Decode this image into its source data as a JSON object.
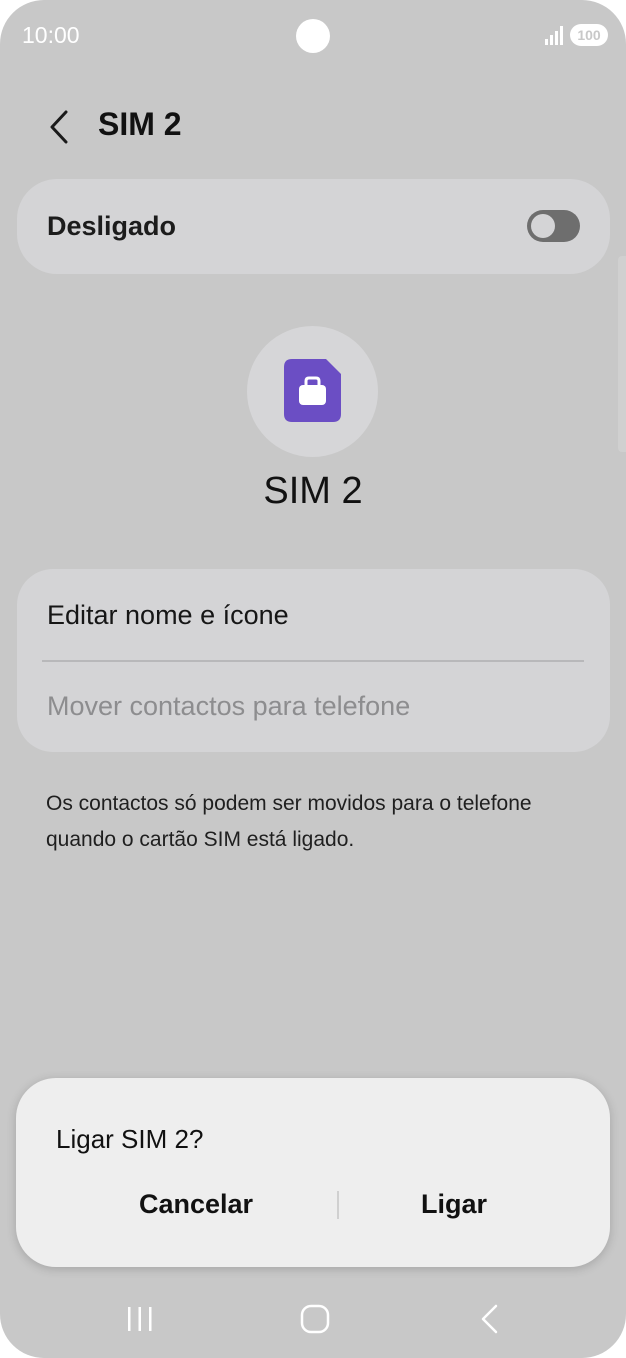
{
  "status_bar": {
    "time": "10:00",
    "battery": "100",
    "icons": [
      "signal-icon",
      "battery-icon"
    ]
  },
  "header": {
    "title": "SIM 2",
    "back_icon": "chevron-left-icon"
  },
  "sim_toggle": {
    "label": "Desligado",
    "state": "off"
  },
  "sim_info": {
    "icon": "sim-card-icon",
    "icon_color": "#6b4ec4",
    "name": "SIM 2"
  },
  "options": {
    "edit_label": "Editar nome e ícone",
    "move_label": "Mover contactos para telefone"
  },
  "info_text": "Os contactos só podem ser movidos para o telefone quando o cartão SIM está ligado.",
  "dialog": {
    "title": "Ligar SIM 2?",
    "cancel_label": "Cancelar",
    "confirm_label": "Ligar"
  },
  "nav_bar": {
    "icons": [
      "recent-apps-icon",
      "home-icon",
      "back-icon"
    ]
  }
}
